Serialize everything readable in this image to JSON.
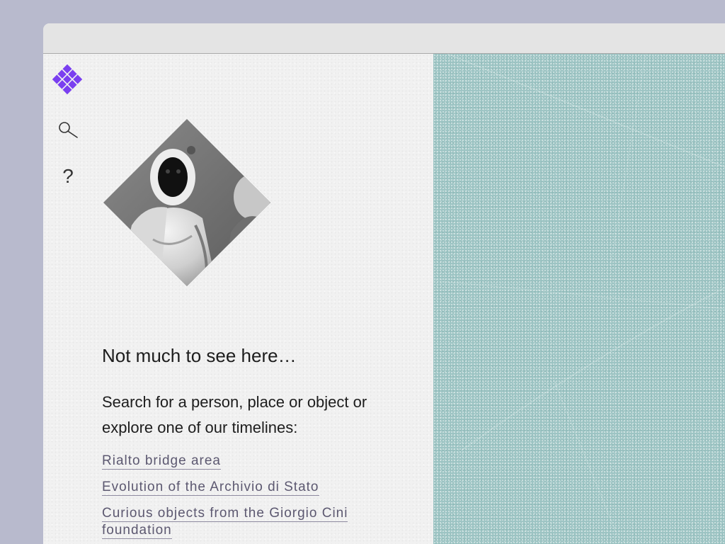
{
  "app": {
    "logo_icon": "diamond-grid-logo-icon",
    "accent_color": "#7a3ff0"
  },
  "nav": {
    "search_icon": "search-icon",
    "help_label": "?"
  },
  "empty_state": {
    "image": "masked-figure-portrait",
    "heading": "Not much to see here…",
    "intro": "Search for a person, place or object or explore one of our timelines:",
    "timelines": [
      {
        "label": "Rialto bridge area"
      },
      {
        "label": "Evolution of the Archivio di Stato"
      },
      {
        "label": "Curious objects from the Giorgio Cini foundation"
      }
    ]
  },
  "map": {
    "background_color": "#9cc4c3"
  }
}
